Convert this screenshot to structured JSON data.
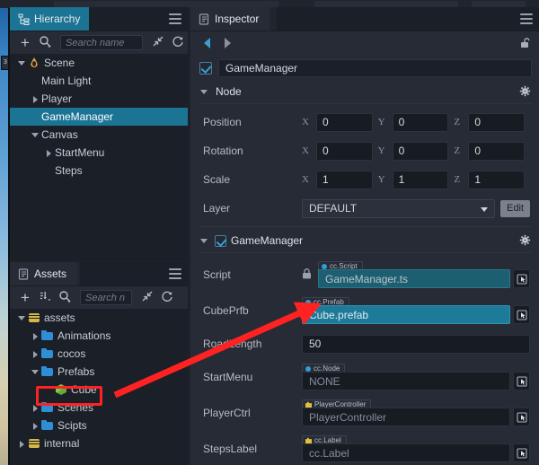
{
  "app": {
    "theme_bg": "#262b35",
    "accent": "#1b7494",
    "annotation_color": "#ff2222"
  },
  "hierarchy": {
    "tab_label": "Hierarchy",
    "tab_icon": "hierarchy-icon",
    "menu_icon": "hamburger-icon",
    "toolbar": {
      "add_label": "+",
      "search_icon": "search-icon",
      "search_placeholder": "Search name",
      "collapse_icon": "collapse-all-icon",
      "refresh_icon": "refresh-icon"
    },
    "nodes": [
      {
        "label": "Scene",
        "indent": 0,
        "arrow": "down",
        "icon": "flame-icon",
        "selected": false
      },
      {
        "label": "Main Light",
        "indent": 1,
        "arrow": "none",
        "icon": "none",
        "selected": false
      },
      {
        "label": "Player",
        "indent": 1,
        "arrow": "right",
        "icon": "none",
        "selected": false
      },
      {
        "label": "GameManager",
        "indent": 1,
        "arrow": "none",
        "icon": "none",
        "selected": true
      },
      {
        "label": "Canvas",
        "indent": 1,
        "arrow": "down",
        "icon": "none",
        "selected": false
      },
      {
        "label": "StartMenu",
        "indent": 2,
        "arrow": "right",
        "icon": "none",
        "selected": false
      },
      {
        "label": "Steps",
        "indent": 2,
        "arrow": "none",
        "icon": "none",
        "selected": false
      }
    ]
  },
  "assets": {
    "tab_label": "Assets",
    "tab_icon": "assets-icon",
    "menu_icon": "hamburger-icon",
    "toolbar": {
      "add_label": "+",
      "sort_icon": "sort-icon",
      "search_icon": "search-icon",
      "search_placeholder": "Search n",
      "collapse_icon": "collapse-all-icon",
      "refresh_icon": "refresh-icon"
    },
    "nodes": [
      {
        "label": "assets",
        "indent": 0,
        "arrow": "down",
        "icon": "db-icon",
        "selected": false,
        "highlighted": false
      },
      {
        "label": "Animations",
        "indent": 1,
        "arrow": "right",
        "icon": "folder-icon",
        "selected": false,
        "highlighted": false
      },
      {
        "label": "cocos",
        "indent": 1,
        "arrow": "right",
        "icon": "folder-icon",
        "selected": false,
        "highlighted": false
      },
      {
        "label": "Prefabs",
        "indent": 1,
        "arrow": "down",
        "icon": "folder-icon",
        "selected": false,
        "highlighted": false
      },
      {
        "label": "Cube",
        "indent": 2,
        "arrow": "none",
        "icon": "cube-icon",
        "selected": false,
        "highlighted": true
      },
      {
        "label": "Scenes",
        "indent": 1,
        "arrow": "right",
        "icon": "folder-icon",
        "selected": false,
        "highlighted": false
      },
      {
        "label": "Scipts",
        "indent": 1,
        "arrow": "right",
        "icon": "folder-icon",
        "selected": false,
        "highlighted": false
      },
      {
        "label": "internal",
        "indent": 0,
        "arrow": "right",
        "icon": "db-icon",
        "selected": false,
        "highlighted": false
      }
    ]
  },
  "inspector": {
    "tab_label": "Inspector",
    "tab_icon": "inspector-icon",
    "menu_icon": "hamburger-icon",
    "nav": {
      "back_icon": "arrow-back-icon",
      "forward_icon": "arrow-forward-icon",
      "lock_icon": "lock-open-icon"
    },
    "node_enabled": true,
    "node_name": "GameManager",
    "node_section": {
      "title": "Node",
      "gear_icon": "gear-icon",
      "position": {
        "label": "Position",
        "x": "0",
        "y": "0",
        "z": "0"
      },
      "rotation": {
        "label": "Rotation",
        "x": "0",
        "y": "0",
        "z": "0"
      },
      "scale": {
        "label": "Scale",
        "x": "1",
        "y": "1",
        "z": "1"
      },
      "layer": {
        "label": "Layer",
        "value": "DEFAULT",
        "edit_label": "Edit"
      },
      "axis_x": "X",
      "axis_y": "Y",
      "axis_z": "Z"
    },
    "component": {
      "title": "GameManager",
      "enabled": true,
      "gear_icon": "gear-icon",
      "fields": [
        {
          "label": "Script",
          "tag": "cc.Script",
          "tag_icon": "script-dot-icon",
          "value": "GameManager.ts",
          "style": "teal",
          "locked": true,
          "picker": true
        },
        {
          "label": "CubePrfb",
          "tag": "cc.Prefab",
          "tag_icon": "prefab-dot-icon",
          "value": "Cube.prefab",
          "style": "tealbright",
          "locked": false,
          "picker": true
        },
        {
          "label": "RoadLength",
          "tag": "",
          "tag_icon": "",
          "value": "50",
          "style": "plain",
          "locked": false,
          "picker": false
        },
        {
          "label": "StartMenu",
          "tag": "cc.Node",
          "tag_icon": "node-tag-icon",
          "value": "NONE",
          "style": "empty",
          "locked": false,
          "picker": true
        },
        {
          "label": "PlayerCtrl",
          "tag": "PlayerController",
          "tag_icon": "puzzle-icon",
          "value": "PlayerController",
          "style": "empty",
          "locked": false,
          "picker": true
        },
        {
          "label": "StepsLabel",
          "tag": "cc.Label",
          "tag_icon": "puzzle-icon",
          "value": "cc.Label",
          "style": "empty",
          "locked": false,
          "picker": true
        }
      ]
    }
  },
  "annotations": {
    "highlight_box_target": "Cube",
    "arrow_from": "Cube asset",
    "arrow_to": "CubePrfb field"
  }
}
